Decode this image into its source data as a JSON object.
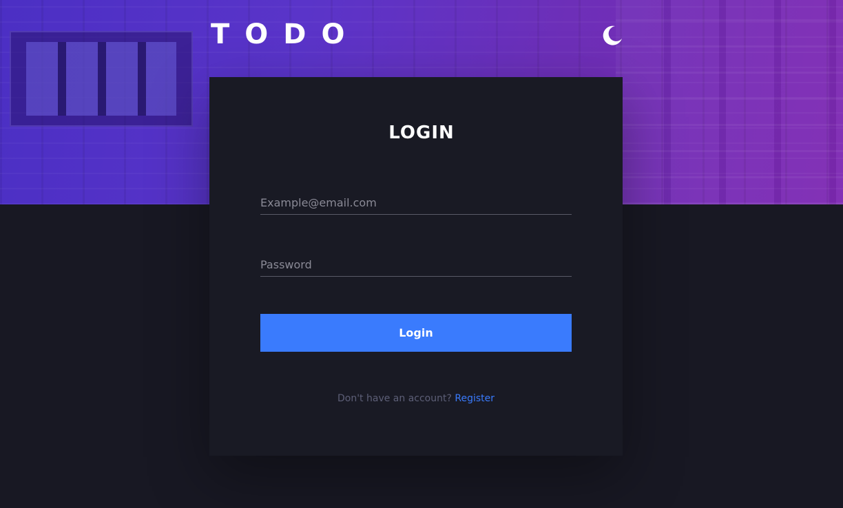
{
  "header": {
    "brand": "TODO",
    "theme_icon": "moon-icon"
  },
  "login_form": {
    "title": "LOGIN",
    "email_placeholder": "Example@email.com",
    "password_placeholder": "Password",
    "submit_label": "Login",
    "footer_prompt": "Don't have an account?",
    "register_label": "Register"
  },
  "colors": {
    "accent": "#3a7bfd",
    "background": "#181823",
    "card": "#191a24",
    "hero_gradient_start": "#4b2fc4",
    "hero_gradient_end": "#7e29b3"
  }
}
